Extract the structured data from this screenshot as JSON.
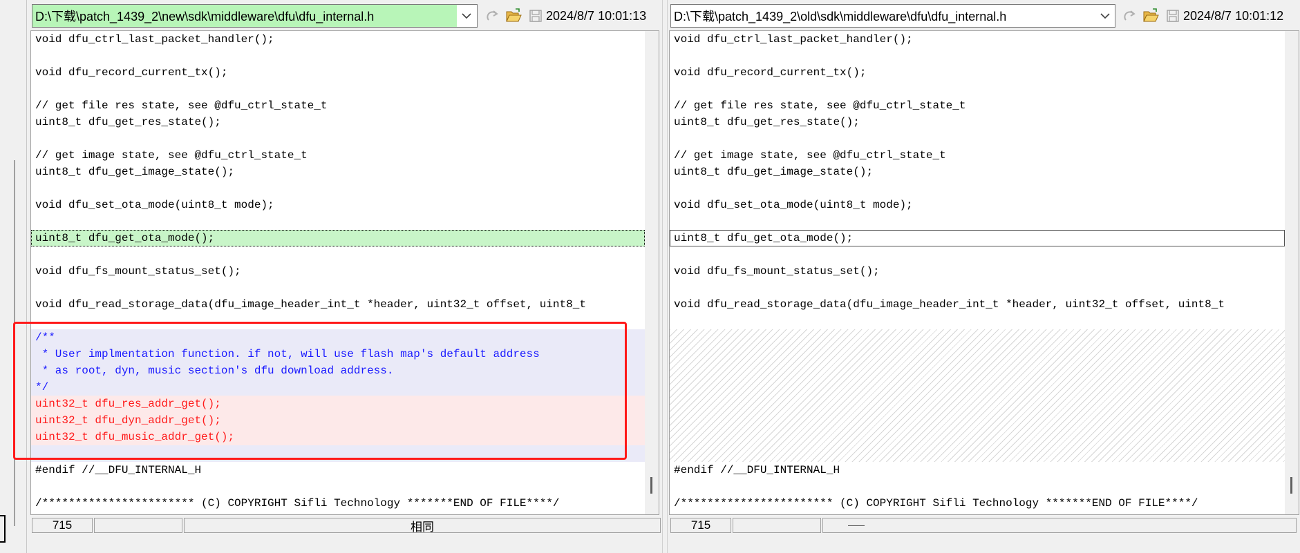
{
  "left": {
    "path": "D:\\下载\\patch_1439_2\\new\\sdk\\middleware\\dfu\\dfu_internal.h",
    "date": "2024/8/7 10:01:13",
    "line_count": "715",
    "status": "相同",
    "lines": [
      {
        "text": "void dfu_ctrl_last_packet_handler();",
        "kind": "normal"
      },
      {
        "text": "",
        "kind": "normal"
      },
      {
        "text": "void dfu_record_current_tx();",
        "kind": "normal"
      },
      {
        "text": "",
        "kind": "normal"
      },
      {
        "text": "// get file res state, see @dfu_ctrl_state_t",
        "kind": "normal"
      },
      {
        "text": "uint8_t dfu_get_res_state();",
        "kind": "normal"
      },
      {
        "text": "",
        "kind": "normal"
      },
      {
        "text": "// get image state, see @dfu_ctrl_state_t",
        "kind": "normal"
      },
      {
        "text": "uint8_t dfu_get_image_state();",
        "kind": "normal"
      },
      {
        "text": "",
        "kind": "normal"
      },
      {
        "text": "void dfu_set_ota_mode(uint8_t mode);",
        "kind": "normal"
      },
      {
        "text": "",
        "kind": "normal"
      },
      {
        "text": "uint8_t dfu_get_ota_mode();",
        "kind": "green-sel"
      },
      {
        "text": "",
        "kind": "normal"
      },
      {
        "text": "void dfu_fs_mount_status_set();",
        "kind": "normal"
      },
      {
        "text": "",
        "kind": "normal"
      },
      {
        "text": "void dfu_read_storage_data(dfu_image_header_int_t *header, uint32_t offset, uint8_t",
        "kind": "normal"
      },
      {
        "text": "",
        "kind": "normal"
      },
      {
        "text": "/**",
        "kind": "comment-add"
      },
      {
        "text": " * User implmentation function. if not, will use flash map's default address",
        "kind": "comment-add"
      },
      {
        "text": " * as root, dyn, music section's dfu download address.",
        "kind": "comment-add"
      },
      {
        "text": "*/",
        "kind": "comment-add"
      },
      {
        "text": "uint32_t dfu_res_addr_get();",
        "kind": "red-add"
      },
      {
        "text": "uint32_t dfu_dyn_addr_get();",
        "kind": "red-add"
      },
      {
        "text": "uint32_t dfu_music_addr_get();",
        "kind": "red-add"
      },
      {
        "text": "",
        "kind": "comment-add"
      },
      {
        "text": "#endif //__DFU_INTERNAL_H",
        "kind": "normal"
      },
      {
        "text": "",
        "kind": "normal"
      },
      {
        "text": "/*********************** (C) COPYRIGHT Sifli Technology *******END OF FILE****/",
        "kind": "normal"
      }
    ]
  },
  "right": {
    "path": "D:\\下载\\patch_1439_2\\old\\sdk\\middleware\\dfu\\dfu_internal.h",
    "date": "2024/8/7 10:01:12",
    "line_count": "715",
    "lines": [
      {
        "text": "void dfu_ctrl_last_packet_handler();",
        "kind": "normal"
      },
      {
        "text": "",
        "kind": "normal"
      },
      {
        "text": "void dfu_record_current_tx();",
        "kind": "normal"
      },
      {
        "text": "",
        "kind": "normal"
      },
      {
        "text": "// get file res state, see @dfu_ctrl_state_t",
        "kind": "normal"
      },
      {
        "text": "uint8_t dfu_get_res_state();",
        "kind": "normal"
      },
      {
        "text": "",
        "kind": "normal"
      },
      {
        "text": "// get image state, see @dfu_ctrl_state_t",
        "kind": "normal"
      },
      {
        "text": "uint8_t dfu_get_image_state();",
        "kind": "normal"
      },
      {
        "text": "",
        "kind": "normal"
      },
      {
        "text": "void dfu_set_ota_mode(uint8_t mode);",
        "kind": "normal"
      },
      {
        "text": "",
        "kind": "normal"
      },
      {
        "text": "uint8_t dfu_get_ota_mode();",
        "kind": "boxed"
      },
      {
        "text": "",
        "kind": "normal"
      },
      {
        "text": "void dfu_fs_mount_status_set();",
        "kind": "normal"
      },
      {
        "text": "",
        "kind": "normal"
      },
      {
        "text": "void dfu_read_storage_data(dfu_image_header_int_t *header, uint32_t offset, uint8_t",
        "kind": "normal"
      },
      {
        "text": "",
        "kind": "normal"
      },
      {
        "text": "",
        "kind": "hatch"
      },
      {
        "text": "",
        "kind": "hatch"
      },
      {
        "text": "",
        "kind": "hatch"
      },
      {
        "text": "",
        "kind": "hatch"
      },
      {
        "text": "",
        "kind": "hatch"
      },
      {
        "text": "",
        "kind": "hatch"
      },
      {
        "text": "",
        "kind": "hatch"
      },
      {
        "text": "",
        "kind": "hatch"
      },
      {
        "text": "#endif //__DFU_INTERNAL_H",
        "kind": "normal"
      },
      {
        "text": "",
        "kind": "normal"
      },
      {
        "text": "/*********************** (C) COPYRIGHT Sifli Technology *******END OF FILE****/",
        "kind": "normal"
      }
    ]
  },
  "icons": {
    "dropdown": "chevron-down-icon",
    "redo": "redo-icon",
    "open": "folder-open-icon",
    "save": "save-icon"
  },
  "colors": {
    "added_comment_bg": "#eaeaf8",
    "added_comment_text": "#1a1aff",
    "added_code_bg": "#fde9e9",
    "added_code_text": "#ff1a1a",
    "selected_line_bg": "#c8f5c8",
    "left_path_bg": "#b8f5b8",
    "annotation_box": "#ff1a1a"
  }
}
